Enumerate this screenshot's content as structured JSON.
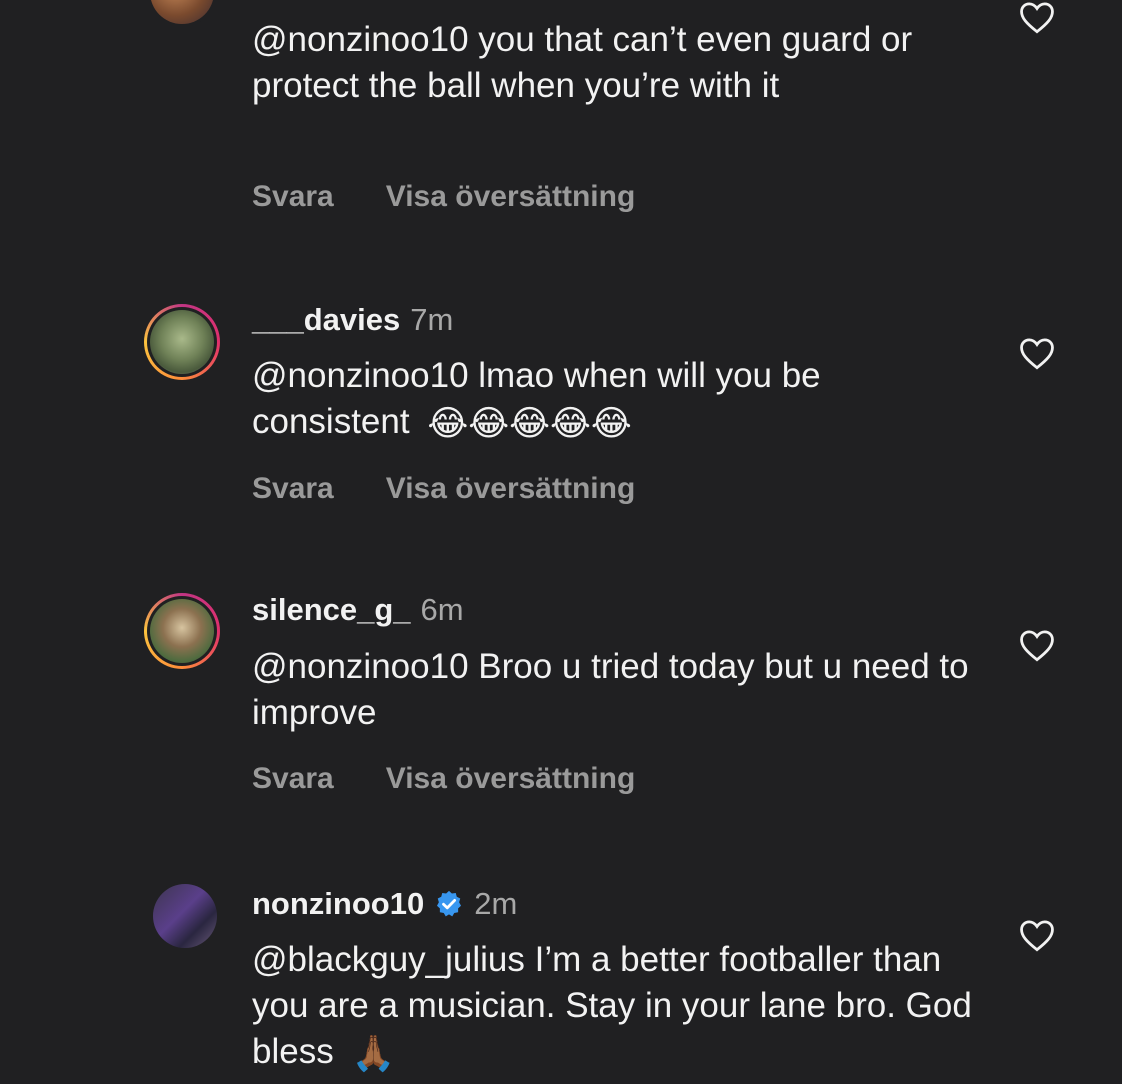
{
  "comments": [
    {
      "username": "",
      "time": "",
      "mention": "@nonzinoo10",
      "text": " you that can’t even guard or protect the ball when you’re with it",
      "reply_label": "Svara",
      "translate_label": "Visa översättning"
    },
    {
      "username": "___davies",
      "time": "7m",
      "mention": "@nonzinoo10",
      "text": " lmao when will you be consistent",
      "emojis": "😂😂😂😂😂",
      "reply_label": "Svara",
      "translate_label": "Visa översättning"
    },
    {
      "username": "silence_g_",
      "time": "6m",
      "mention": "@nonzinoo10",
      "text": " Broo u tried today but u need to improve",
      "reply_label": "Svara",
      "translate_label": "Visa översättning"
    },
    {
      "username": "nonzinoo10",
      "time": "2m",
      "verified": true,
      "mention": "@blackguy_julius",
      "text": " I’m a better footballer than you are a musician. Stay in your lane bro. God bless",
      "emojis": "🙏🏾"
    }
  ],
  "colors": {
    "background": "#202022",
    "text": "#f2f2f2",
    "muted": "#a8a8a8",
    "verified": "#3897f0"
  },
  "icons": [
    "heart-icon",
    "verified-badge-icon"
  ]
}
